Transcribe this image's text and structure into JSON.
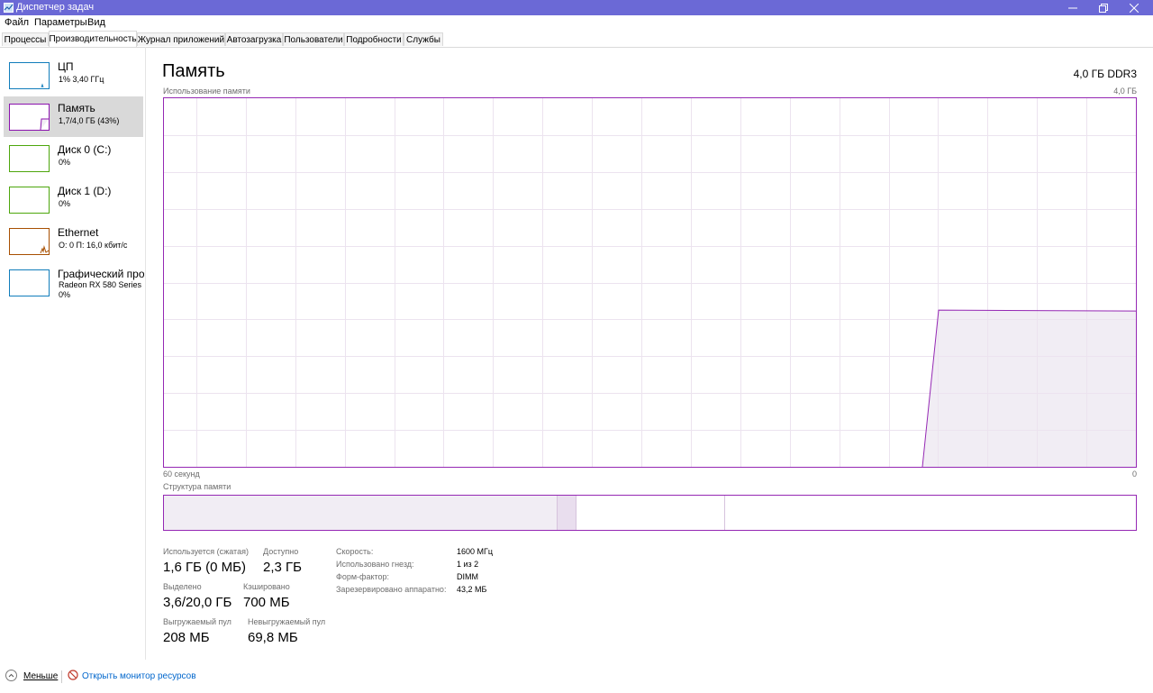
{
  "window": {
    "title": "Диспетчер задач",
    "accent_color": "#6b69d6",
    "controls": [
      "minimize-icon",
      "restore-icon",
      "close-icon"
    ]
  },
  "menu": {
    "file": "Файл",
    "options": "Параметры",
    "view": "Вид"
  },
  "tabs": [
    "Процессы",
    "Производительность",
    "Журнал приложений",
    "Автозагрузка",
    "Пользователи",
    "Подробности",
    "Службы"
  ],
  "active_tab": "Производительность",
  "sidebar": [
    {
      "name": "ЦП",
      "detail": "1% 3,40 ГГц",
      "color": "#117dbb"
    },
    {
      "name": "Память",
      "detail": "1,7/4,0 ГБ (43%)",
      "color": "#8b12ae"
    },
    {
      "name": "Диск 0 (C:)",
      "detail": "0%",
      "color": "#4da60c"
    },
    {
      "name": "Диск 1 (D:)",
      "detail": "0%",
      "color": "#4da60c"
    },
    {
      "name": "Ethernet",
      "detail": "О: 0 П: 16,0 кбит/с",
      "color": "#a74f01"
    },
    {
      "name": "Графический про",
      "detail": "Radeon RX 580 Series",
      "detail2": "0%",
      "color": "#117dbb"
    }
  ],
  "memory": {
    "title": "Память",
    "spec": "4,0 ГБ DDR3",
    "usage_label": "Использование памяти",
    "usage_max": "4,0 ГБ",
    "time_left": "60 секунд",
    "time_right": "0",
    "structure_label": "Структура памяти",
    "graph_color": "#9528b4",
    "graph_fill": "#f1edf4",
    "usage_fraction": 0.425
  },
  "stats": {
    "in_use_label": "Используется (сжатая)",
    "in_use": "1,6 ГБ (0 МБ)",
    "available_label": "Доступно",
    "available": "2,3 ГБ",
    "committed_label": "Выделено",
    "committed": "3,6/20,0 ГБ",
    "cached_label": "Кэшировано",
    "cached": "700 МБ",
    "paged_label": "Выгружаемый пул",
    "paged": "208 МБ",
    "nonpaged_label": "Невыгружаемый пул",
    "nonpaged": "69,8 МБ"
  },
  "hardware": {
    "speed_label": "Скорость:",
    "speed": "1600 МГц",
    "slots_label": "Использовано гнезд:",
    "slots": "1 из 2",
    "form_label": "Форм-фактор:",
    "form": "DIMM",
    "reserved_label": "Зарезервировано аппаратно:",
    "reserved": "43,2 МБ"
  },
  "footer": {
    "less": "Меньше",
    "resource_monitor": "Открыть монитор ресурсов"
  }
}
